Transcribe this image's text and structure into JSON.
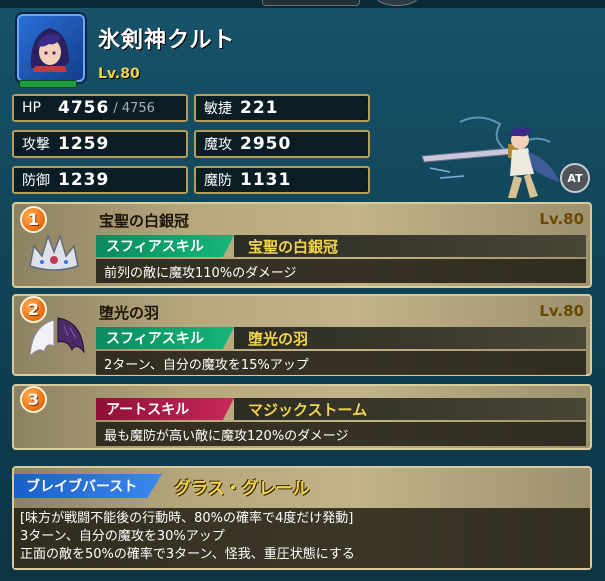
{
  "character": {
    "name": "氷剣神クルト",
    "level": "Lv.80",
    "at_label": "AT"
  },
  "stats": {
    "hp_label": "HP",
    "hp_value": "4756",
    "hp_max": "/ 4756",
    "speed_label": "敏捷",
    "speed_value": "221",
    "atk_label": "攻撃",
    "atk_value": "1259",
    "matk_label": "魔攻",
    "matk_value": "2950",
    "def_label": "防御",
    "def_value": "1239",
    "mdef_label": "魔防",
    "mdef_value": "1131"
  },
  "skills": [
    {
      "number": "1",
      "name": "宝聖の白銀冠",
      "level": "Lv.80",
      "type": "スフィアスキル",
      "skill_name": "宝聖の白銀冠",
      "description": "前列の敵に魔攻110%のダメージ",
      "icon": "silver-crown-icon"
    },
    {
      "number": "2",
      "name": "堕光の羽",
      "level": "Lv.80",
      "type": "スフィアスキル",
      "skill_name": "堕光の羽",
      "description": "2ターン、自分の魔攻を15%アップ",
      "icon": "wings-icon"
    },
    {
      "number": "3",
      "type": "アートスキル",
      "skill_name": "マジックストーム",
      "description": "最も魔防が高い敵に魔攻120%のダメージ"
    }
  ],
  "brave_burst": {
    "label": "ブレイブバースト",
    "name": "グラス・グレール",
    "lines": [
      "[味方が戦闘不能後の行動時、80%の確率で4度だけ発動]",
      "3ターン、自分の魔攻を30%アップ",
      "正面の敵を50%の確率で3ターン、怪我、重圧状態にする"
    ]
  },
  "colors": {
    "sophia_tag": "#15b67a",
    "art_tag": "#c8285a",
    "brave_tag": "#3b88ef",
    "gold_text": "#f2d44c"
  }
}
